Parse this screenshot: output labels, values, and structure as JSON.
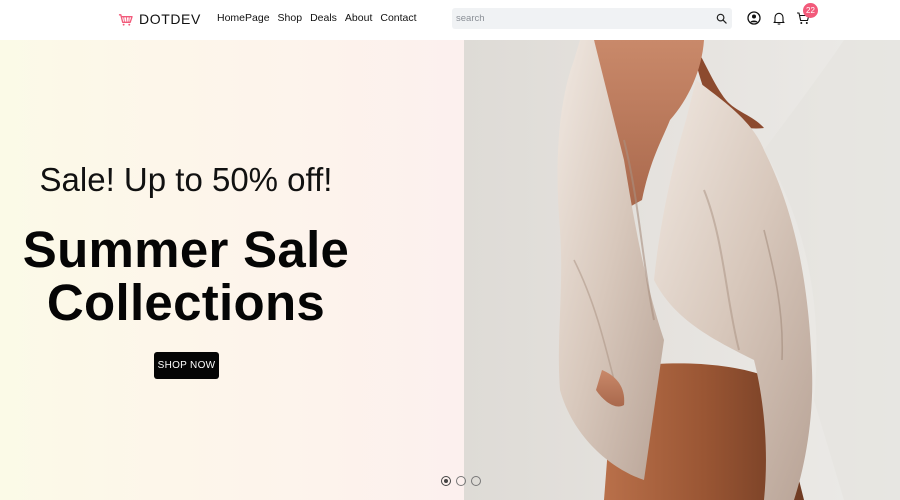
{
  "brand": {
    "name": "DOTDEV",
    "icon": "shopping-basket-icon",
    "accent": "#f25a7a"
  },
  "nav": {
    "links": [
      {
        "label": "HomePage"
      },
      {
        "label": "Shop"
      },
      {
        "label": "Deals"
      },
      {
        "label": "About"
      },
      {
        "label": "Contact"
      }
    ]
  },
  "search": {
    "placeholder": "search",
    "value": "",
    "icon": "search-icon"
  },
  "header_icons": {
    "user": "user-circle-icon",
    "notifications": "bell-icon",
    "cart": "cart-icon"
  },
  "cart": {
    "count": "22"
  },
  "hero": {
    "subtitle": "Sale! Up to 50% off!",
    "title_line1": "Summer Sale",
    "title_line2": "Collections",
    "button_label": "SHOP NOW",
    "image": "woman-in-linen-shirt-photo",
    "slides_total": 3,
    "active_slide": 1
  },
  "colors": {
    "button_bg": "#050505",
    "badge_bg": "#f25a7a",
    "search_bg": "#f0f2f4"
  }
}
